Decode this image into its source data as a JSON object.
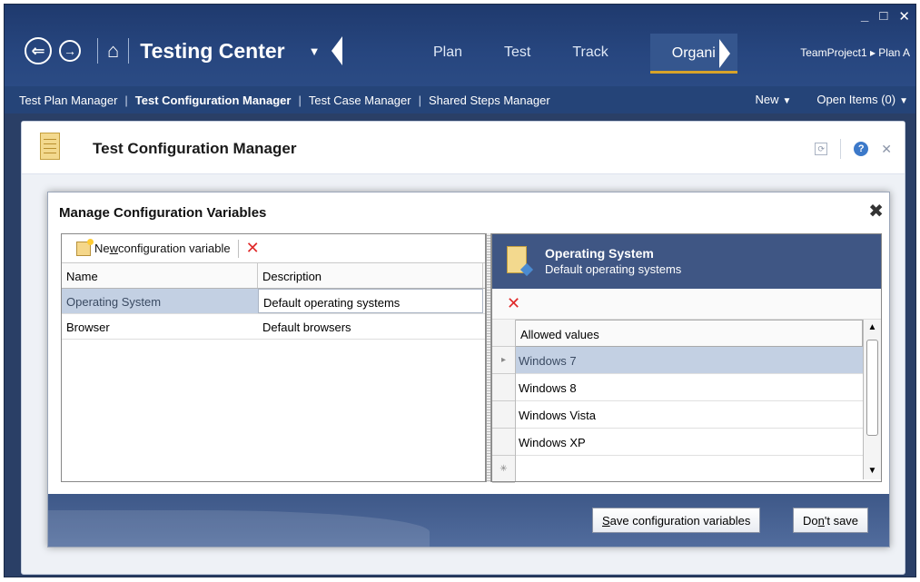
{
  "window": {
    "minimize": "_",
    "maximize": "□",
    "close": "✕"
  },
  "nav": {
    "back_icon": "⇐",
    "forward_icon": "→",
    "home_icon": "⌂",
    "app_title": "Testing Center",
    "app_caret": "▼",
    "tabs": [
      {
        "label": "Plan"
      },
      {
        "label": "Test"
      },
      {
        "label": "Track"
      },
      {
        "label": "Organi"
      }
    ],
    "team_project": "TeamProject1 ▸ Plan A"
  },
  "subnav": {
    "items": [
      "Test Plan Manager",
      "Test Configuration Manager",
      "Test Case Manager",
      "Shared Steps Manager"
    ],
    "new_label": "New",
    "open_items_label": "Open Items (0)",
    "caret": "▼"
  },
  "content": {
    "title": "Test Configuration Manager",
    "refresh_icon": "⟳",
    "help_icon": "?",
    "close_icon": "✕"
  },
  "dialog": {
    "title": "Manage Configuration Variables",
    "close": "✖",
    "new_variable_prefix": "Ne",
    "new_variable_access": "w",
    "new_variable_suffix": " configuration variable",
    "delete_icon": "✕",
    "columns": {
      "name": "Name",
      "description": "Description"
    },
    "rows": [
      {
        "name": "Operating System",
        "description": "Default operating systems"
      },
      {
        "name": "Browser",
        "description": "Default browsers"
      }
    ],
    "detail": {
      "title": "Operating System",
      "subtitle": "Default operating systems",
      "delete_icon": "✕",
      "column": "Allowed values",
      "values": [
        "Windows 7",
        "Windows 8",
        "Windows Vista",
        "Windows XP"
      ],
      "new_row_marker": "✳",
      "current_row_marker": "▸",
      "scroll_up": "▲",
      "scroll_down": "▼"
    },
    "save_access": "S",
    "save_rest": "ave configuration variables",
    "dont_prefix": "Do",
    "dont_access": "n",
    "dont_suffix": "'t save"
  }
}
